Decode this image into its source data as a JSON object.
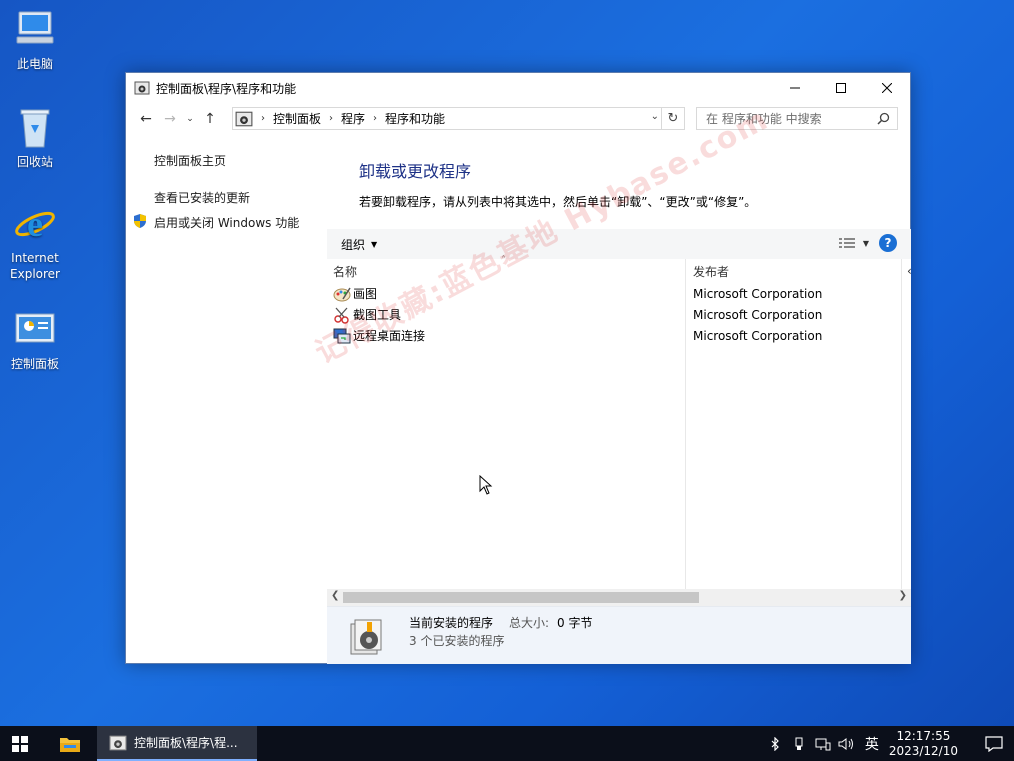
{
  "desktop": {
    "icons": [
      {
        "label": "此电脑"
      },
      {
        "label": "回收站"
      },
      {
        "label": "Internet\nExplorer"
      },
      {
        "label": "控制面板"
      }
    ]
  },
  "window": {
    "title": "控制面板\\程序\\程序和功能",
    "breadcrumb": [
      "控制面板",
      "程序",
      "程序和功能"
    ],
    "search_placeholder": "在 程序和功能 中搜索",
    "left_links": {
      "home": "控制面板主页",
      "updates": "查看已安装的更新",
      "features": "启用或关闭 Windows 功能"
    },
    "heading": "卸载或更改程序",
    "description": "若要卸载程序，请从列表中将其选中，然后单击“卸载”、“更改”或“修复”。",
    "toolbar": {
      "organize": "组织"
    },
    "columns": {
      "name": "名称",
      "publisher": "发布者"
    },
    "programs": [
      {
        "name": "画图",
        "publisher": "Microsoft Corporation",
        "icon": "paint-icon"
      },
      {
        "name": "截图工具",
        "publisher": "Microsoft Corporation",
        "icon": "snipping-tool-icon"
      },
      {
        "name": "远程桌面连接",
        "publisher": "Microsoft Corporation",
        "icon": "remote-desktop-icon"
      }
    ],
    "details": {
      "title": "当前安装的程序",
      "size_label": "总大小:",
      "size_value": "0 字节",
      "count": "3 个已安装的程序"
    }
  },
  "watermark": "记得收藏:蓝色基地  Hybase.com",
  "taskbar": {
    "task_label": "控制面板\\程序\\程...",
    "ime": "英",
    "time": "12:17:55",
    "date": "2023/12/10"
  },
  "colors": {
    "accent": "#1a6fd4",
    "heading": "#1e3287",
    "desktop": "#1b6fe0"
  }
}
